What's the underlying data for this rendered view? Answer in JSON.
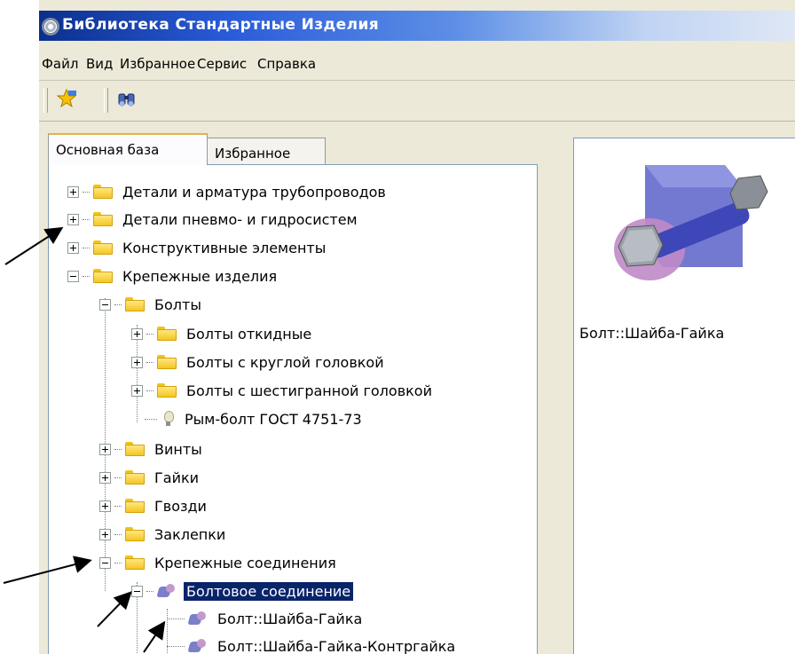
{
  "window": {
    "title": "Библиотека Стандартные Изделия"
  },
  "menu": [
    "Файл",
    "Вид",
    "Избранное",
    "Сервис",
    "Справка"
  ],
  "toolbar": {
    "buttons": [
      "favorites-add-icon",
      "binoculars-search-icon"
    ]
  },
  "tabs": [
    {
      "label": "Основная база",
      "active": true
    },
    {
      "label": "Избранное",
      "active": false
    }
  ],
  "tree": {
    "items": [
      {
        "label": "Детали и арматура трубопроводов",
        "level": 0,
        "state": "collapsed",
        "icon": "folder-icon"
      },
      {
        "label": "Детали пневмо- и гидросистем",
        "level": 0,
        "state": "collapsed",
        "icon": "folder-icon"
      },
      {
        "label": "Конструктивные элементы",
        "level": 0,
        "state": "collapsed",
        "icon": "folder-icon"
      },
      {
        "label": "Крепежные изделия",
        "level": 0,
        "state": "expanded",
        "icon": "folder-icon"
      },
      {
        "label": "Болты",
        "level": 1,
        "state": "expanded",
        "icon": "folder-icon"
      },
      {
        "label": "Болты откидные",
        "level": 2,
        "state": "collapsed",
        "icon": "folder-icon"
      },
      {
        "label": "Болты с круглой головкой",
        "level": 2,
        "state": "collapsed",
        "icon": "folder-icon"
      },
      {
        "label": "Болты с шестигранной головкой",
        "level": 2,
        "state": "collapsed",
        "icon": "folder-icon"
      },
      {
        "label": "Рым-болт ГОСТ 4751-73",
        "level": 2,
        "state": "leaf",
        "icon": "bulb-icon"
      },
      {
        "label": "Винты",
        "level": 1,
        "state": "collapsed",
        "icon": "folder-icon"
      },
      {
        "label": "Гайки",
        "level": 1,
        "state": "collapsed",
        "icon": "folder-icon"
      },
      {
        "label": "Гвозди",
        "level": 1,
        "state": "collapsed",
        "icon": "folder-icon"
      },
      {
        "label": "Заклепки",
        "level": 1,
        "state": "collapsed",
        "icon": "folder-icon"
      },
      {
        "label": "Крепежные соединения",
        "level": 1,
        "state": "expanded",
        "icon": "folder-icon"
      },
      {
        "label": "Болтовое соединение",
        "level": 2,
        "state": "expanded",
        "icon": "assembly-icon",
        "selected": true
      },
      {
        "label": "Болт::Шайба-Гайка",
        "level": 3,
        "state": "leaf",
        "icon": "assembly-icon"
      },
      {
        "label": "Болт::Шайба-Гайка-Контргайка",
        "level": 3,
        "state": "leaf",
        "icon": "assembly-icon"
      }
    ]
  },
  "preview": {
    "caption": "Болт::Шайба-Гайка"
  },
  "colors": {
    "selection": "#0a246a",
    "title_gradient_start": "#0b2f8c"
  }
}
